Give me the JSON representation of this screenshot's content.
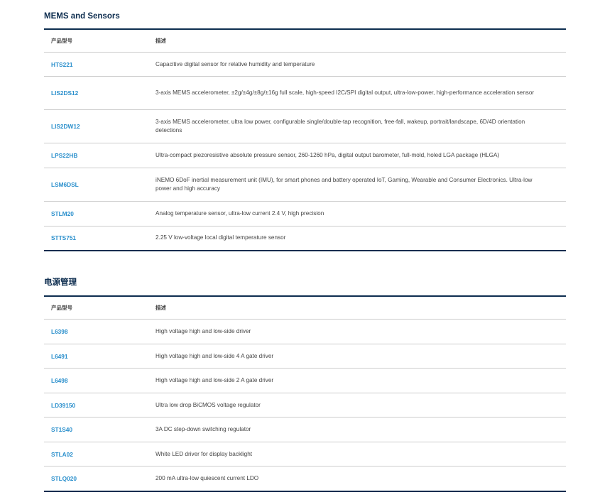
{
  "mems": {
    "title": "MEMS and Sensors",
    "header": {
      "part": "产品型号",
      "desc": "描述"
    },
    "rows": [
      {
        "part": "HTS221",
        "desc": "Capacitive digital sensor for relative humidity and temperature"
      },
      {
        "part": "LIS2DS12",
        "desc": "3-axis MEMS accelerometer, ±2g/±4g/±8g/±16g full scale, high-speed I2C/SPI digital output, ultra-low-power, high-performance acceleration sensor"
      },
      {
        "part": "LIS2DW12",
        "desc": "3-axis MEMS accelerometer, ultra low power, configurable single/double-tap recognition, free-fall, wakeup, portrait/landscape, 6D/4D orientation detections"
      },
      {
        "part": "LPS22HB",
        "desc": "Ultra-compact piezoresistive absolute pressure sensor, 260-1260 hPa, digital output barometer, full-mold, holed LGA package (HLGA)"
      },
      {
        "part": "LSM6DSL",
        "desc": "iNEMO 6DoF inertial measurement unit (IMU), for smart phones and battery operated IoT, Gaming, Wearable and Consumer Electronics. Ultra-low power and high accuracy"
      },
      {
        "part": "STLM20",
        "desc": "Analog temperature sensor, ultra-low current 2.4 V, high precision"
      },
      {
        "part": "STTS751",
        "desc": "2.25 V low-voltage local digital temperature sensor"
      }
    ]
  },
  "power": {
    "title": "电源管理",
    "header": {
      "part": "产品型号",
      "desc": "描述"
    },
    "rows": [
      {
        "part": "L6398",
        "desc": "High voltage high and low-side driver"
      },
      {
        "part": "L6491",
        "desc": "High voltage high and low-side 4 A gate driver"
      },
      {
        "part": "L6498",
        "desc": "High voltage high and low-side 2 A gate driver"
      },
      {
        "part": "LD39150",
        "desc": "Ultra low drop BiCMOS voltage regulator"
      },
      {
        "part": "ST1S40",
        "desc": "3A DC step-down switching regulator"
      },
      {
        "part": "STLA02",
        "desc": "White LED driver for display backlight"
      },
      {
        "part": "STLQ020",
        "desc": "200 mA ultra-low quiescent current LDO"
      }
    ]
  }
}
